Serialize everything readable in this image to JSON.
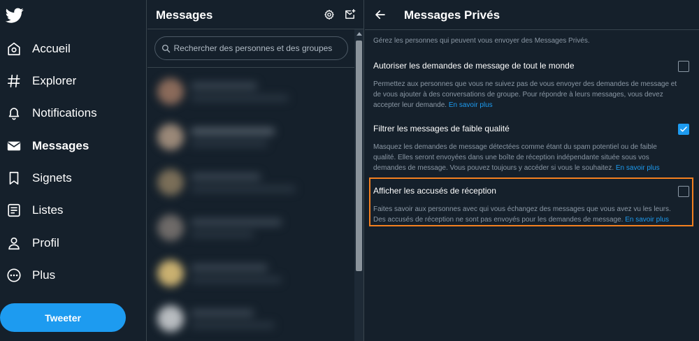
{
  "nav": {
    "logo": "twitter-bird-icon",
    "items": [
      {
        "label": "Accueil",
        "icon": "home-icon"
      },
      {
        "label": "Explorer",
        "icon": "hashtag-icon"
      },
      {
        "label": "Notifications",
        "icon": "bell-icon"
      },
      {
        "label": "Messages",
        "icon": "envelope-icon",
        "active": true
      },
      {
        "label": "Signets",
        "icon": "bookmark-icon"
      },
      {
        "label": "Listes",
        "icon": "list-icon"
      },
      {
        "label": "Profil",
        "icon": "person-icon"
      },
      {
        "label": "Plus",
        "icon": "more-circle-icon"
      }
    ],
    "tweet_button": "Tweeter"
  },
  "messages": {
    "title": "Messages",
    "search_placeholder": "Rechercher des personnes et des groupes"
  },
  "settings": {
    "title": "Messages Privés",
    "intro": "Gérez les personnes qui peuvent vous envoyer des Messages Privés.",
    "options": [
      {
        "title": "Autoriser les demandes de message de tout le monde",
        "description": "Permettez aux personnes que vous ne suivez pas de vous envoyer des demandes de message et de vous ajouter à des conversations de groupe. Pour répondre à leurs messages, vous devez accepter leur demande.",
        "link": "En savoir plus",
        "checked": false
      },
      {
        "title": "Filtrer les messages de faible qualité",
        "description": "Masquez les demandes de message détectées comme étant du spam potentiel ou de faible qualité. Elles seront envoyées dans une boîte de réception indépendante située sous vos demandes de message. Vous pouvez toujours y accéder si vous le souhaitez.",
        "link": "En savoir plus",
        "checked": true
      },
      {
        "title": "Afficher les accusés de réception",
        "description": "Faites savoir aux personnes avec qui vous échangez des messages que vous avez vu les leurs. Des accusés de réception ne sont pas envoyés pour les demandes de message.",
        "link": "En savoir plus",
        "checked": false
      }
    ]
  },
  "colors": {
    "background": "#15202b",
    "accent": "#1d9bf0",
    "highlight": "#f4801f",
    "muted_text": "#8b98a5"
  }
}
